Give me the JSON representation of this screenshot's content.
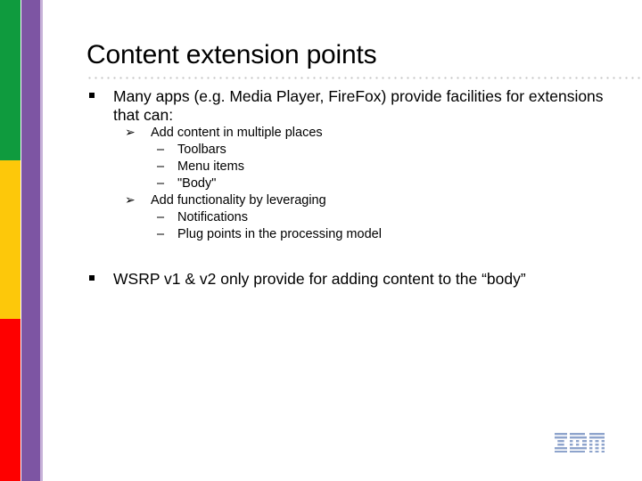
{
  "slide": {
    "title": "Content extension points",
    "bullets": [
      {
        "level": 1,
        "marker": "square-bullet",
        "text": "Many apps (e.g. Media Player, FireFox) provide facilities for extensions that can:"
      },
      {
        "level": 2,
        "marker": "➢",
        "text": "Add content in multiple places"
      },
      {
        "level": 3,
        "marker": "–",
        "text": "Toolbars"
      },
      {
        "level": 3,
        "marker": "–",
        "text": "Menu items"
      },
      {
        "level": 3,
        "marker": "–",
        "text": "\"Body\""
      },
      {
        "level": 2,
        "marker": "➢",
        "text": "Add functionality by leveraging"
      },
      {
        "level": 3,
        "marker": "–",
        "text": "Notifications"
      },
      {
        "level": 3,
        "marker": "–",
        "text": "Plug points in the processing model"
      },
      {
        "level": 1,
        "marker": "square-bullet",
        "text": "WSRP v1 & v2 only provide for adding content to the “body”"
      }
    ]
  },
  "rail": {
    "segments": [
      {
        "name": "green",
        "color": "#0f9b3e"
      },
      {
        "name": "yellow",
        "color": "#fdc80a"
      },
      {
        "name": "red",
        "color": "#fe0000"
      }
    ],
    "accent_purple": "#7d55a3",
    "accent_purple_light": "#c7b2d8"
  },
  "branding": {
    "logo_text": "IBM",
    "logo_color": "#8ea4cc"
  },
  "icons": {
    "square_bullet": "square-bullet-icon",
    "arrow_bullet": "arrow-bullet-icon",
    "dash_bullet": "dash-bullet-icon"
  }
}
